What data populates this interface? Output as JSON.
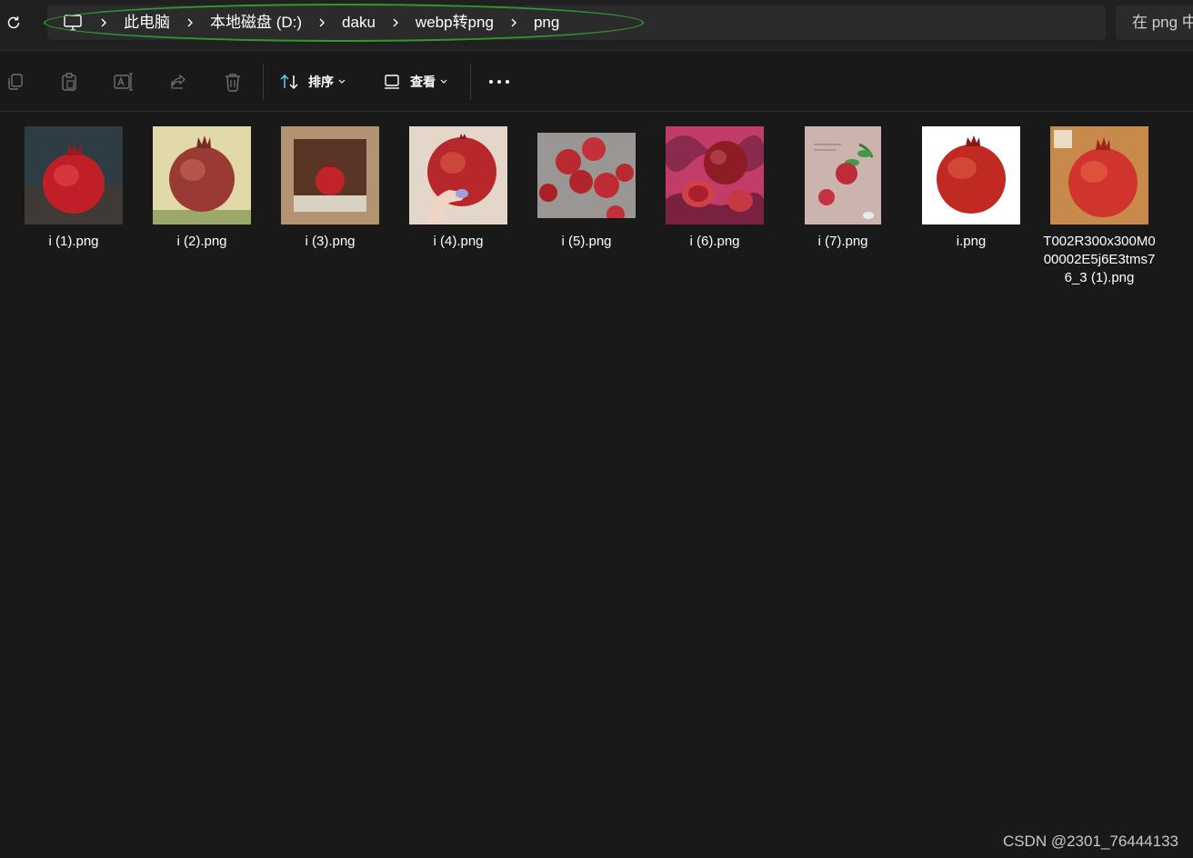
{
  "breadcrumb": {
    "items": [
      "此电脑",
      "本地磁盘 (D:)",
      "daku",
      "webp转png",
      "png"
    ]
  },
  "search": {
    "text": "在 png 中"
  },
  "toolbar": {
    "sort_label": "排序",
    "view_label": "查看"
  },
  "files": [
    {
      "name": "i (1).png",
      "thumb_style": "dark-wood"
    },
    {
      "name": "i (2).png",
      "thumb_style": "cream-painting"
    },
    {
      "name": "i (3).png",
      "thumb_style": "framed-painting"
    },
    {
      "name": "i (4).png",
      "thumb_style": "hand-held"
    },
    {
      "name": "i (5).png",
      "thumb_style": "grey-cluster"
    },
    {
      "name": "i (6).png",
      "thumb_style": "pink-pattern"
    },
    {
      "name": "i (7).png",
      "thumb_style": "botanical"
    },
    {
      "name": "i.png",
      "thumb_style": "white-bg"
    },
    {
      "name": "T002R300x300M000002E5j6E3tms76_3 (1).png",
      "thumb_style": "orange-painting"
    }
  ],
  "watermark": "CSDN @2301_76444133",
  "colors": {
    "background": "#191919",
    "addressbar": "#2b2b2b",
    "highlight": "#2e9a2e",
    "pomegranate": "#c8242a",
    "accent": "#60cdff"
  },
  "icons": [
    "refresh-icon",
    "computer-icon",
    "chevron-right-icon",
    "copy-icon",
    "paste-icon",
    "rename-icon",
    "share-icon",
    "delete-icon",
    "sort-icon",
    "view-icon",
    "more-icon"
  ]
}
